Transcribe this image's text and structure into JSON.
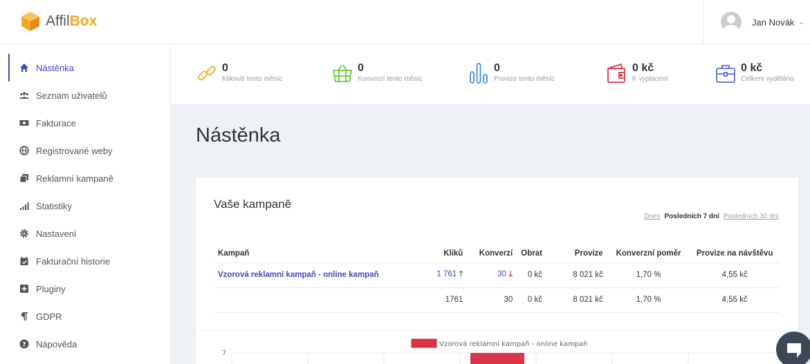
{
  "brand": {
    "name_part1": "Affil",
    "name_part2": "Box"
  },
  "user": {
    "name": "Jan Novák",
    "caret": "⌄"
  },
  "sidebar": {
    "items": [
      {
        "label": "Nástěnka",
        "icon": "home-icon",
        "active": true
      },
      {
        "label": "Seznam uživatelů",
        "icon": "users-icon"
      },
      {
        "label": "Fakturace",
        "icon": "money-icon"
      },
      {
        "label": "Registrované weby",
        "icon": "globe-icon"
      },
      {
        "label": "Reklamní kampaně",
        "icon": "clone-icon"
      },
      {
        "label": "Statistiky",
        "icon": "signal-icon"
      },
      {
        "label": "Nastavení",
        "icon": "gear-icon"
      },
      {
        "label": "Fakturační historie",
        "icon": "calendar-icon"
      },
      {
        "label": "Pluginy",
        "icon": "plus-square-icon"
      },
      {
        "label": "GDPR",
        "icon": "paragraph-icon"
      },
      {
        "label": "Nápověda",
        "icon": "question-icon"
      }
    ]
  },
  "stats": [
    {
      "value": "0",
      "label": "Kliknutí tento měsíc",
      "icon": "link-icon",
      "color": "#f5a623"
    },
    {
      "value": "0",
      "label": "Konverzí tento měsíc",
      "icon": "basket-icon",
      "color": "#6cc83a"
    },
    {
      "value": "0",
      "label": "Provize tento měsíc",
      "icon": "bars-icon",
      "color": "#3b8fd9"
    },
    {
      "value": "0 kč",
      "label": "K vyplacení",
      "icon": "wallet-icon",
      "color": "#e03140"
    },
    {
      "value": "0 kč",
      "label": "Celkem vyděláno",
      "icon": "briefcase-icon",
      "color": "#5b6bd6"
    }
  ],
  "page": {
    "title": "Nástěnka"
  },
  "campaigns": {
    "title": "Vaše kampaně",
    "periods": {
      "today": "Dnes",
      "week": "Posledních 7 dní",
      "month": "Posledních 30 dní"
    },
    "columns": [
      "Kampaň",
      "Kliků",
      "Konverzí",
      "Obrat",
      "Provize",
      "Konverzní poměr",
      "Provize na návštěvu"
    ],
    "rows": [
      {
        "name": "Vzorová reklamní kampaň - online kampaň",
        "clicks": "1 761",
        "clicks_arrow": "🡑",
        "conversions": "30",
        "conversions_arrow": "🡓",
        "turnover": "0 kč",
        "commission": "8 021 kč",
        "ratio": "1,70 %",
        "per_visit": "4,55 kč"
      }
    ],
    "totals": {
      "clicks": "1761",
      "conversions": "30",
      "turnover": "0 kč",
      "commission": "8 021 kč",
      "ratio": "1,70 %",
      "per_visit": "4,55 kč"
    }
  },
  "chart_data": {
    "type": "bar",
    "series": [
      {
        "name": "Vzorová reklamní kampaň - online kampaň",
        "color": "#d9344a"
      }
    ],
    "y_tick_top": "7",
    "ylim": [
      0,
      7
    ]
  }
}
